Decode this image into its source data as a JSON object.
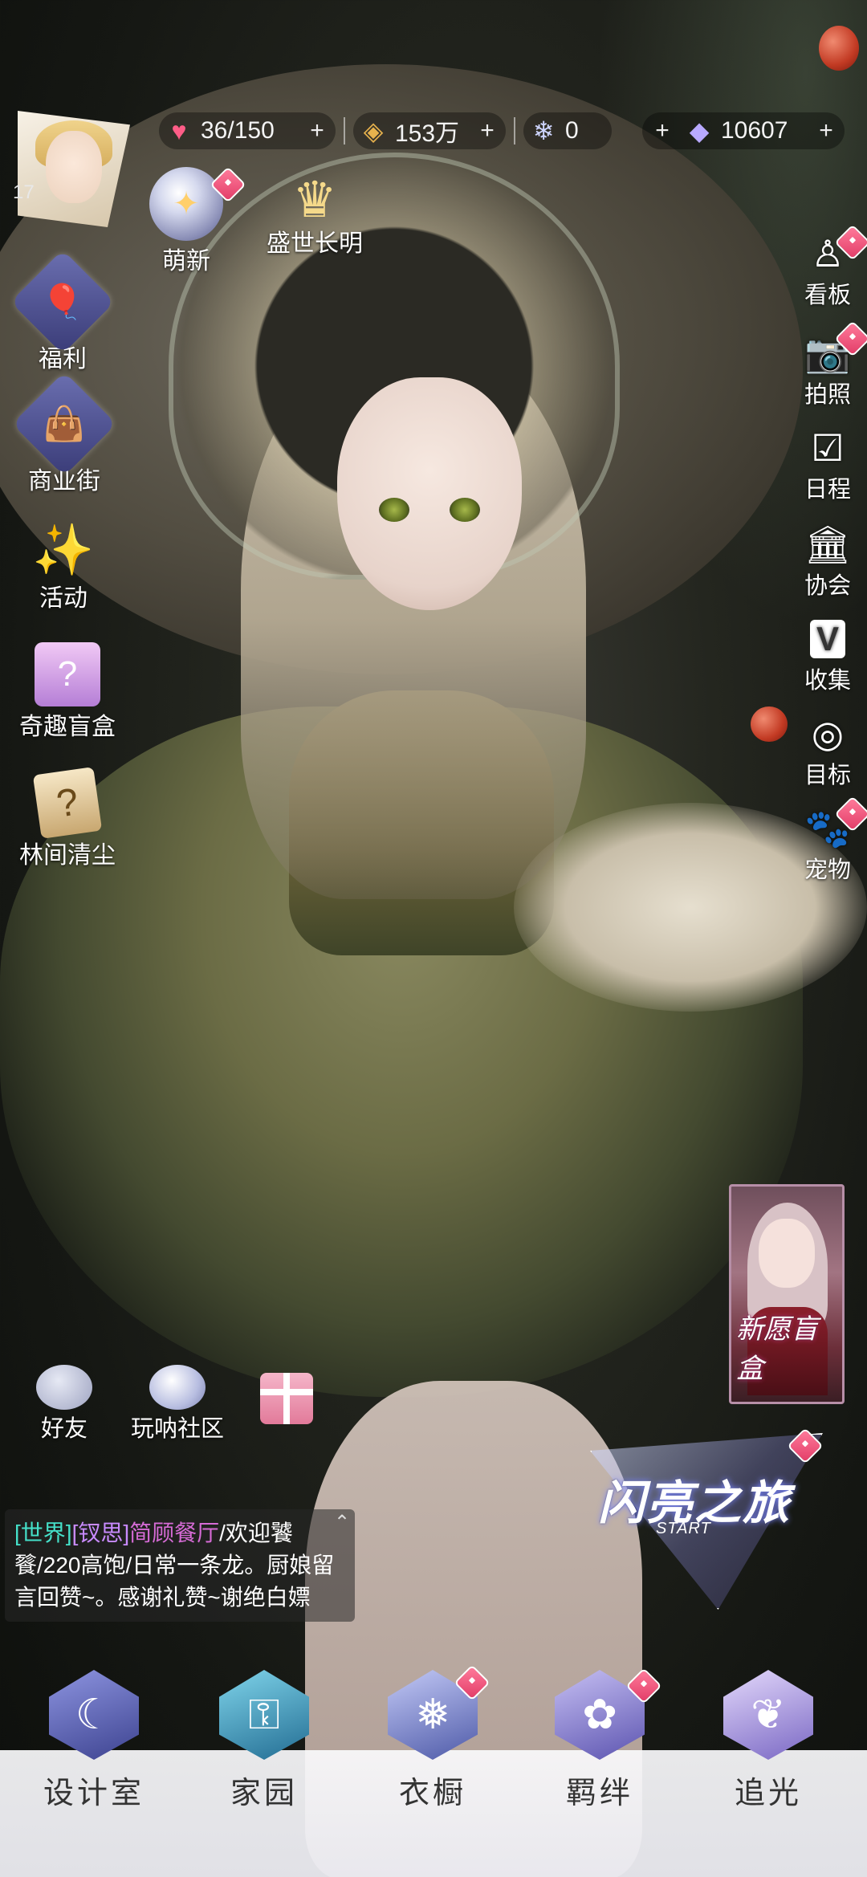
{
  "colors": {
    "accent_pink": "#e23d68",
    "chat_channel": "#45e0c9",
    "chat_tag": "#c98bff",
    "chat_nick": "#d66bd6"
  },
  "player": {
    "level": "17",
    "avatar_icon": "player-avatar"
  },
  "resources": [
    {
      "name": "stamina",
      "icon": "heart-icon",
      "glyph": "♥",
      "color": "#ff5d87",
      "value": "36/150"
    },
    {
      "name": "gold",
      "icon": "coin-icon",
      "glyph": "◈",
      "color": "#e7b24d",
      "value": "153万"
    },
    {
      "name": "snowflake",
      "icon": "snowflake-gem-icon",
      "glyph": "❄",
      "color": "#cfd6ff",
      "value": "0"
    },
    {
      "name": "diamond",
      "icon": "diamond-icon",
      "glyph": "◆",
      "color": "#b8a9ff",
      "value": "10607"
    }
  ],
  "left_menu": [
    {
      "id": "mengxin",
      "label": "萌新",
      "icon": "crystal-ball-icon",
      "glyph": "✦"
    },
    {
      "id": "shengshi",
      "label": "盛世长明",
      "icon": "crown-icon",
      "glyph": "♛"
    },
    {
      "id": "fuli",
      "label": "福利",
      "icon": "balloon-icon",
      "glyph": "🎈"
    },
    {
      "id": "shangyejie",
      "label": "商业街",
      "icon": "shopping-bag-icon",
      "glyph": "👜"
    },
    {
      "id": "huodong",
      "label": "活动",
      "icon": "stars-icon",
      "glyph": "✨"
    },
    {
      "id": "qiqumanghe",
      "label": "奇趣盲盒",
      "icon": "mystery-box-icon",
      "glyph": "🎁"
    },
    {
      "id": "linjianqingchen",
      "label": "林间清尘",
      "icon": "question-card-icon",
      "glyph": "?"
    }
  ],
  "right_menu": [
    {
      "id": "kanban",
      "label": "看板",
      "icon": "figure-icon",
      "glyph": "♙"
    },
    {
      "id": "paizhao",
      "label": "拍照",
      "icon": "camera-icon",
      "glyph": "📷"
    },
    {
      "id": "richeng",
      "label": "日程",
      "icon": "calendar-check-icon",
      "glyph": "☑"
    },
    {
      "id": "xiehui",
      "label": "协会",
      "icon": "building-icon",
      "glyph": "🏛"
    },
    {
      "id": "shouji",
      "label": "收集",
      "icon": "v-badge-icon",
      "glyph": "V"
    },
    {
      "id": "mubiao",
      "label": "目标",
      "icon": "target-badge-icon",
      "glyph": "◎"
    },
    {
      "id": "chongwu",
      "label": "宠物",
      "icon": "paw-icon",
      "glyph": "🐾"
    }
  ],
  "social": [
    {
      "id": "haoyou",
      "label": "好友",
      "icon": "friends-bubble-icon"
    },
    {
      "id": "wannashequ",
      "label": "玩呐社区",
      "icon": "community-planet-icon"
    }
  ],
  "gift_icon": "gift-box-icon",
  "blind_box_card": {
    "label": "新愿盲盒"
  },
  "journey_banner": {
    "title": "闪亮之旅",
    "subtitle": "START"
  },
  "chat": {
    "channel": "[世界]",
    "tag": "[钗思]",
    "nick": "简顾餐厅",
    "message": "/欢迎饕餮/220高饱/日常一条龙。厨娘留言回赞~。感谢礼赞~谢绝白嫖",
    "collapse_icon": "chevron-up-icon"
  },
  "bottom_nav": [
    {
      "id": "shejishi",
      "label": "设计室",
      "icon": "moon-gem-icon",
      "glyph": "☾",
      "color": "#4b52a8"
    },
    {
      "id": "jiayuan",
      "label": "家园",
      "icon": "key-gem-icon",
      "glyph": "⚿",
      "color": "#2c7aa0"
    },
    {
      "id": "yichu",
      "label": "衣橱",
      "icon": "snowflake-gem-icon",
      "glyph": "❅",
      "color": "#5d6ab5"
    },
    {
      "id": "jiban",
      "label": "羁绊",
      "icon": "flower-gem-icon",
      "glyph": "✿",
      "color": "#7066c2"
    },
    {
      "id": "zhuiguang",
      "label": "追光",
      "icon": "butterfly-gem-icon",
      "glyph": "❦",
      "color": "#8a7ad0"
    }
  ]
}
